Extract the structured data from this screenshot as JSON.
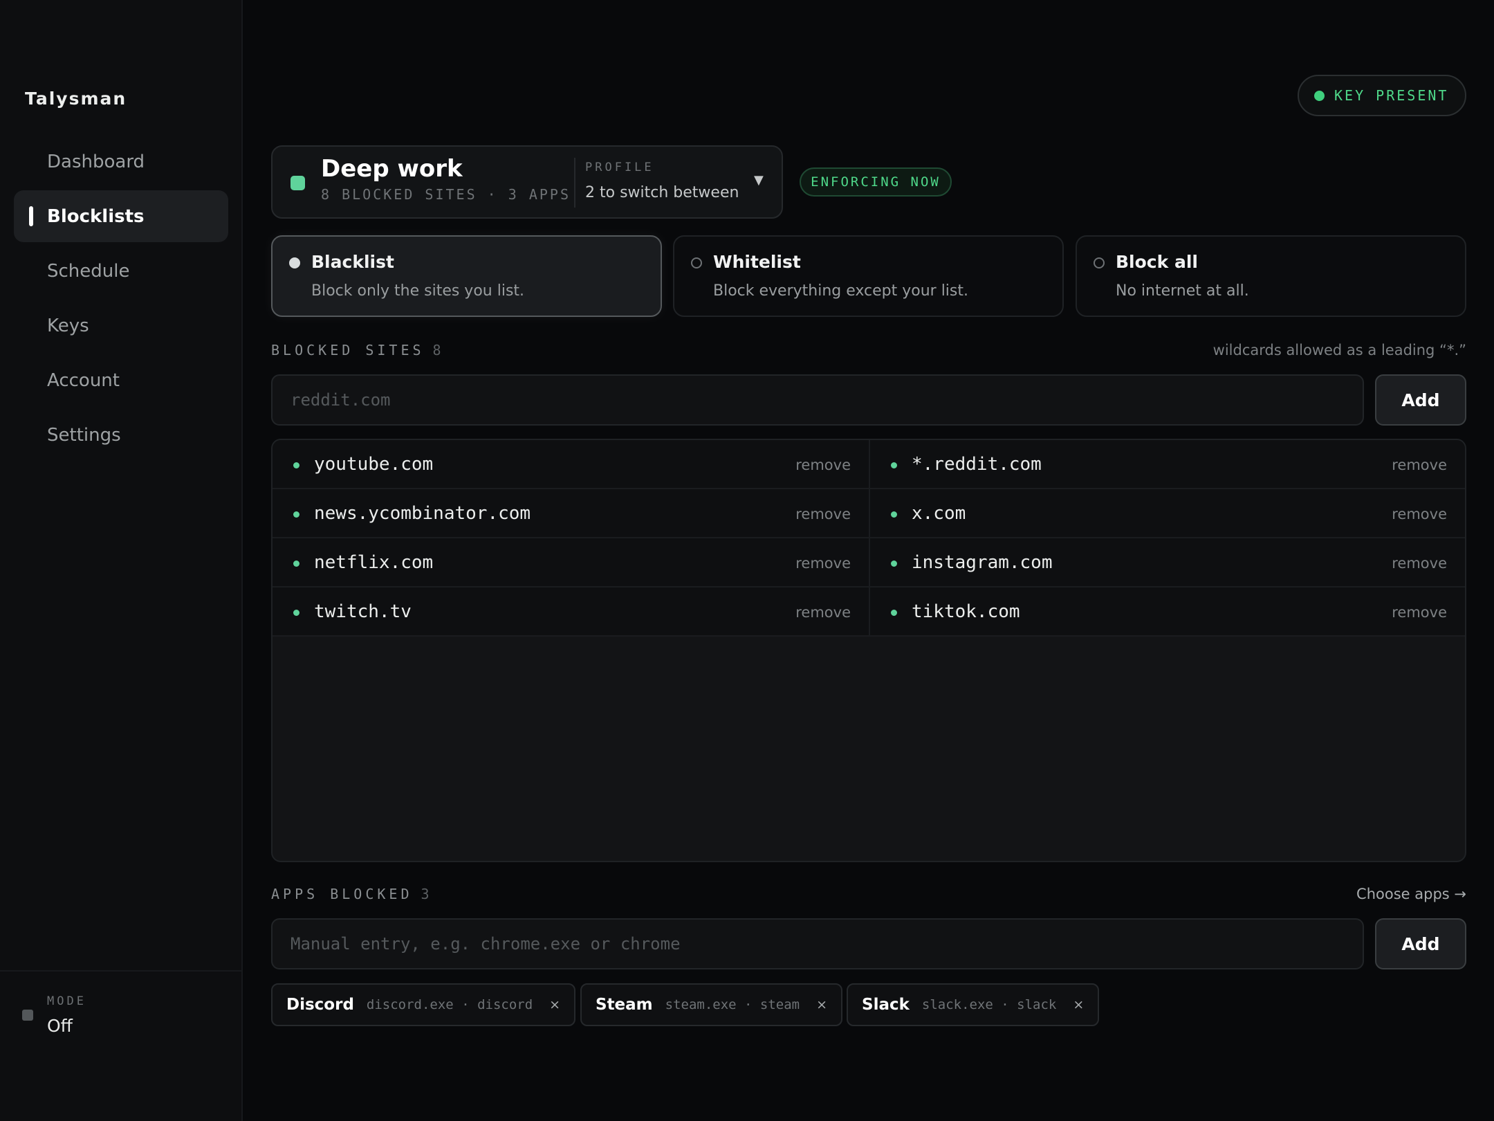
{
  "app": {
    "name": "Talysman"
  },
  "sidebar": {
    "items": [
      {
        "label": "Dashboard",
        "active": false
      },
      {
        "label": "Blocklists",
        "active": true
      },
      {
        "label": "Schedule",
        "active": false
      },
      {
        "label": "Keys",
        "active": false
      },
      {
        "label": "Account",
        "active": false
      },
      {
        "label": "Settings",
        "active": false
      }
    ],
    "mode": {
      "label": "MODE",
      "value": "Off"
    }
  },
  "header": {
    "key_status": "KEY PRESENT",
    "enforcing": "ENFORCING NOW"
  },
  "profile": {
    "name": "Deep work",
    "meta": "8 BLOCKED SITES · 3 APPS",
    "label": "PROFILE",
    "sub": "2 to switch between",
    "swatch_color": "#5fd39b"
  },
  "modes": [
    {
      "title": "Blacklist",
      "desc": "Block only the sites you list.",
      "selected": true
    },
    {
      "title": "Whitelist",
      "desc": "Block everything except your list.",
      "selected": false
    },
    {
      "title": "Block all",
      "desc": "No internet at all.",
      "selected": false
    }
  ],
  "sites": {
    "label": "BLOCKED SITES",
    "count": "8",
    "hint": "wildcards allowed as a leading “*.”",
    "input_placeholder": "reddit.com",
    "add_label": "Add",
    "remove_label": "remove",
    "list": [
      "youtube.com",
      "*.reddit.com",
      "news.ycombinator.com",
      "x.com",
      "netflix.com",
      "instagram.com",
      "twitch.tv",
      "tiktok.com"
    ]
  },
  "apps": {
    "label": "APPS BLOCKED",
    "count": "3",
    "choose_label": "Choose apps →",
    "input_placeholder": "Manual entry, e.g. chrome.exe or chrome",
    "add_label": "Add",
    "chips": [
      {
        "name": "Discord",
        "meta": "discord.exe · discord"
      },
      {
        "name": "Steam",
        "meta": "steam.exe · steam"
      },
      {
        "name": "Slack",
        "meta": "slack.exe · slack"
      }
    ],
    "remove_glyph": "×"
  },
  "colors": {
    "accent_green": "#4fd98a",
    "background": "#08090b",
    "sidebar": "#0d0e10"
  }
}
